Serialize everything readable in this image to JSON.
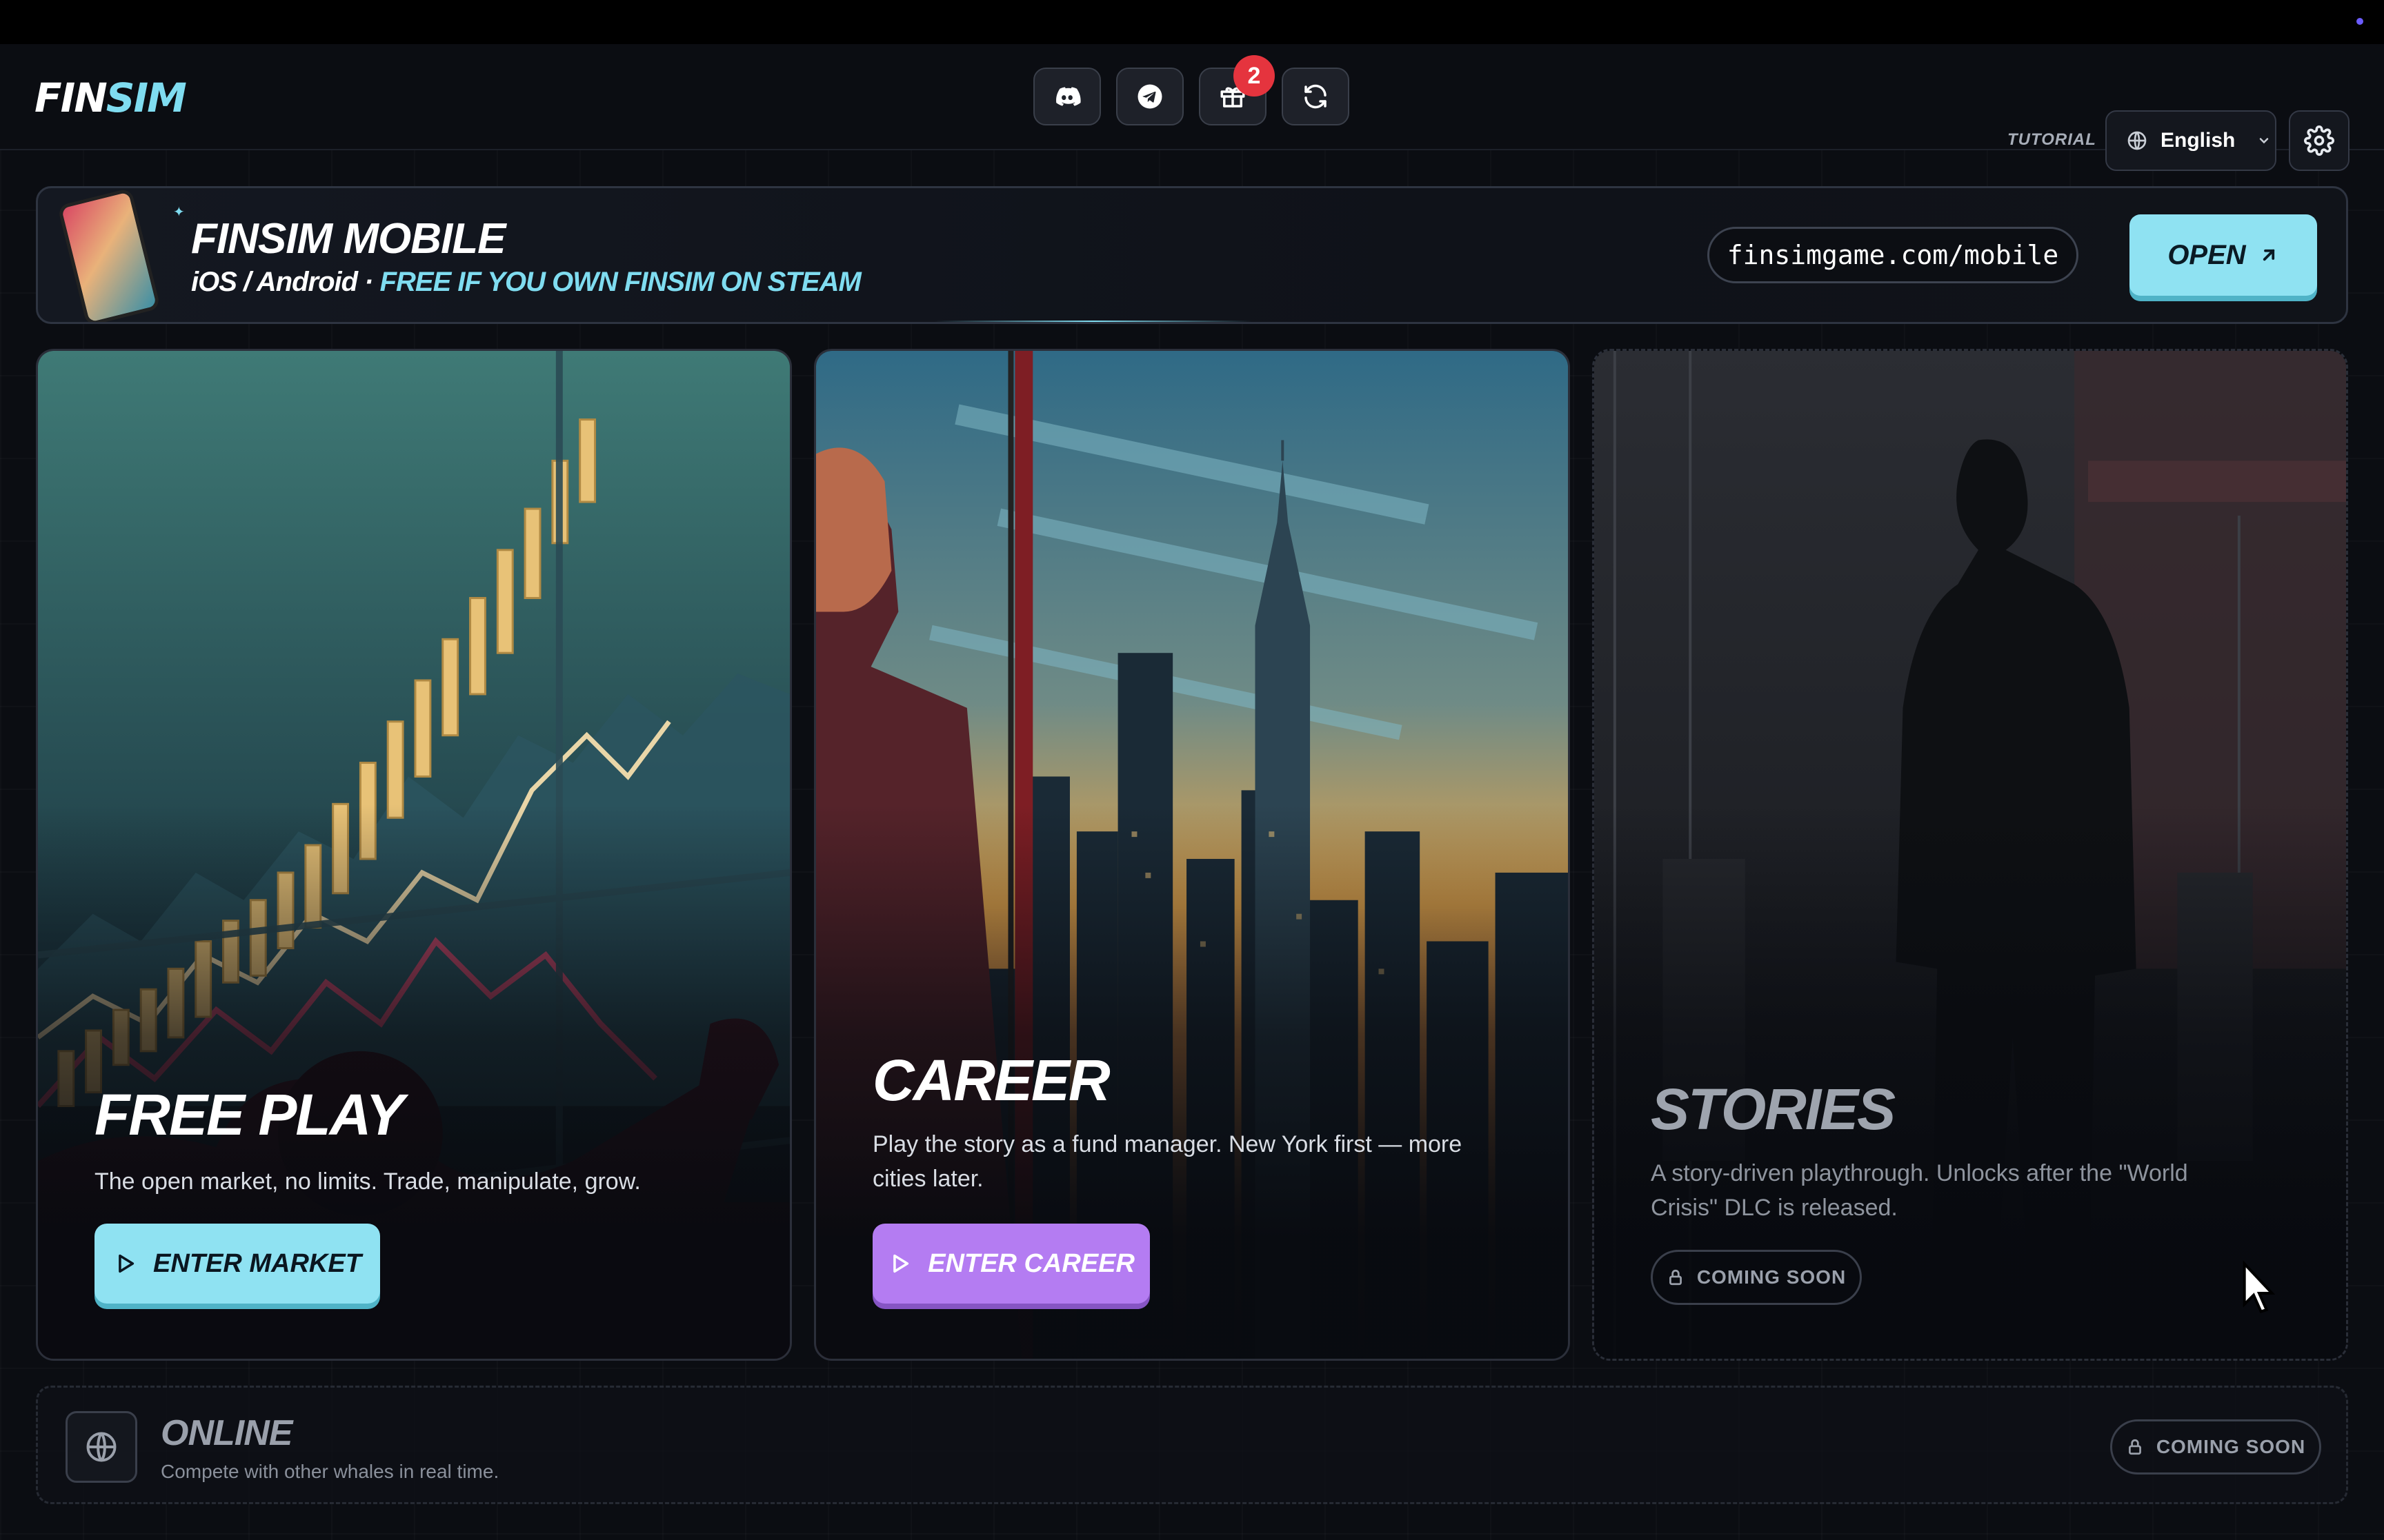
{
  "header": {
    "logo_part1": "FIN",
    "logo_part2": "SIM",
    "notification_count": "2",
    "tutorial_label": "TUTORIAL",
    "language": "English",
    "icons": [
      "discord-icon",
      "telegram-icon",
      "gift-icon",
      "refresh-icon",
      "globe-icon",
      "gear-icon"
    ]
  },
  "banner": {
    "title": "FINSIM MOBILE",
    "platforms": "iOS / Android · ",
    "free_text": "FREE IF YOU OWN FINSIM ON STEAM",
    "url": "finsimgame.com/mobile",
    "open_label": "OPEN"
  },
  "cards": [
    {
      "title": "FREE PLAY",
      "description": "The open market, no limits. Trade, manipulate, grow.",
      "button_label": "ENTER MARKET",
      "accent": "#8fe2f2"
    },
    {
      "title": "CAREER",
      "description": "Play the story as a fund manager. New York first — more cities later.",
      "button_label": "ENTER CAREER",
      "accent": "#b47cf2"
    },
    {
      "title": "STORIES",
      "description": "A story-driven playthrough. Unlocks after the \"World Crisis\" DLC is released.",
      "status_label": "COMING SOON"
    }
  ],
  "online": {
    "title": "ONLINE",
    "description": "Compete with other whales in real time.",
    "status_label": "COMING SOON"
  },
  "colors": {
    "background": "#0b0d12",
    "accent_cyan": "#7fdcf0",
    "accent_purple": "#b47cf2",
    "badge_red": "#e5343e"
  }
}
